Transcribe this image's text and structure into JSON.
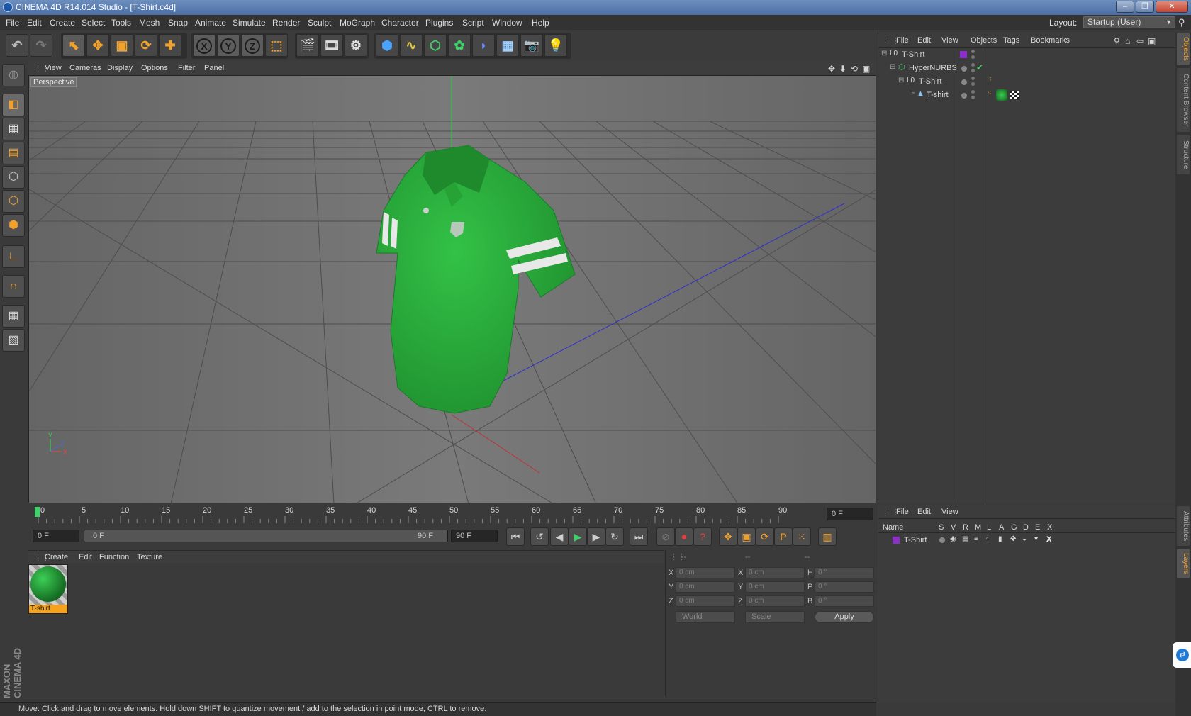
{
  "window": {
    "title": "CINEMA 4D R14.014 Studio - [T-Shirt.c4d]"
  },
  "menubar": {
    "items": [
      "File",
      "Edit",
      "Create",
      "Select",
      "Tools",
      "Mesh",
      "Snap",
      "Animate",
      "Simulate",
      "Render",
      "Sculpt",
      "MoGraph",
      "Character",
      "Plugins",
      "Script",
      "Window",
      "Help"
    ],
    "layout_label": "Layout:",
    "layout_value": "Startup (User)"
  },
  "toolbar": {
    "axis_x": "X",
    "axis_y": "Y",
    "axis_z": "Z"
  },
  "viewport": {
    "menu": [
      "View",
      "Cameras",
      "Display",
      "Options",
      "Filter",
      "Panel"
    ],
    "label": "Perspective"
  },
  "timeline": {
    "ticks": [
      "0",
      "5",
      "10",
      "15",
      "20",
      "25",
      "30",
      "35",
      "40",
      "45",
      "50",
      "55",
      "60",
      "65",
      "70",
      "75",
      "80",
      "85",
      "90"
    ],
    "current_frame_field": "0 F"
  },
  "transport": {
    "start_field": "0 F",
    "range_start": "0 F",
    "range_end": "90 F",
    "end_field": "90 F"
  },
  "material_manager": {
    "menu": [
      "Create",
      "Edit",
      "Function",
      "Texture"
    ],
    "materials": [
      {
        "name": "T-shirt"
      }
    ]
  },
  "coordinates": {
    "header": [
      "--",
      "--",
      "--"
    ],
    "rows": [
      {
        "a": "X",
        "v1": "0 cm",
        "b": "X",
        "v2": "0 cm",
        "c": "H",
        "v3": "0 °"
      },
      {
        "a": "Y",
        "v1": "0 cm",
        "b": "Y",
        "v2": "0 cm",
        "c": "P",
        "v3": "0 °"
      },
      {
        "a": "Z",
        "v1": "0 cm",
        "b": "Z",
        "v2": "0 cm",
        "c": "B",
        "v3": "0 °"
      }
    ],
    "mode": "World",
    "transform": "Scale",
    "apply": "Apply"
  },
  "object_manager": {
    "menu": [
      "File",
      "Edit",
      "View",
      "Objects",
      "Tags",
      "Bookmarks"
    ],
    "objects": [
      {
        "name": "T-Shirt"
      },
      {
        "name": "HyperNURBS"
      },
      {
        "name": "T-Shirt"
      },
      {
        "name": "T-shirt"
      }
    ]
  },
  "layer_manager": {
    "menu": [
      "File",
      "Edit",
      "View"
    ],
    "columns": [
      "Name",
      "S",
      "V",
      "R",
      "M",
      "L",
      "A",
      "G",
      "D",
      "E",
      "X"
    ],
    "layers": [
      {
        "name": "T-Shirt"
      }
    ],
    "layer_color": "#8b2fc9"
  },
  "right_tabs": [
    "Objects",
    "Content Browser",
    "Structure",
    "Attributes",
    "Layers"
  ],
  "status": "Move: Click and drag to move elements. Hold down SHIFT to quantize movement / add to the selection in point mode, CTRL to remove.",
  "brand": "MAXON CINEMA 4D",
  "colors": {
    "shirt": "#2aa63a",
    "accent": "#f2a12b",
    "material_label": "#f5a21c"
  }
}
